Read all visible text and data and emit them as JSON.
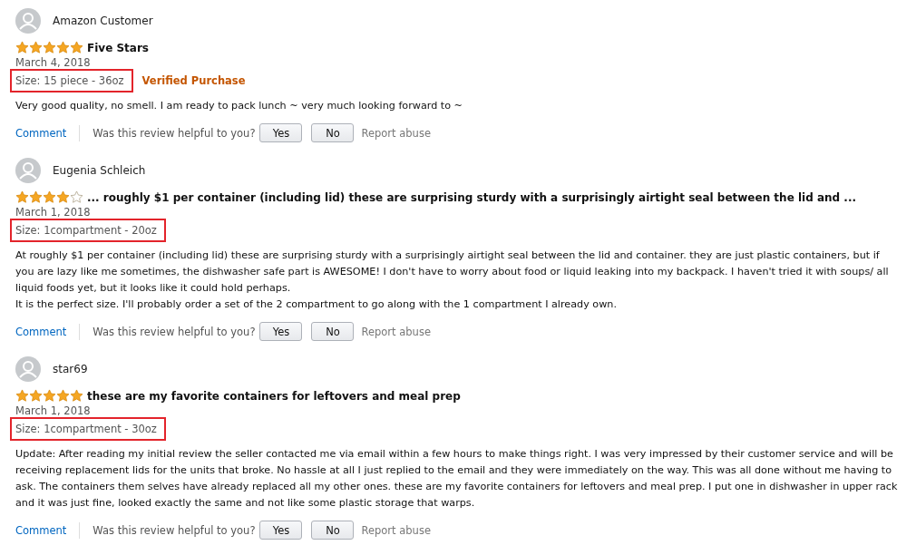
{
  "reviews": [
    {
      "author": "Amazon Customer",
      "stars": 5,
      "title": "Five Stars",
      "date": "March 4, 2018",
      "size": "Size: 15 piece - 36oz",
      "badge": "Verified Purchase",
      "body": [
        "Very good quality, no smell. I am ready to pack lunch ~ very much looking forward to ~"
      ],
      "actions": {
        "comment": "Comment",
        "question": "Was this review helpful to you?",
        "yes": "Yes",
        "no": "No",
        "report": "Report abuse"
      }
    },
    {
      "author": "Eugenia Schleich",
      "stars": 4,
      "title": "... roughly $1 per container (including lid) these are surprising sturdy with a surprisingly airtight seal between the lid and ...",
      "date": "March 1, 2018",
      "size": "Size: 1compartment - 20oz",
      "body": [
        "At roughly $1 per container (including lid) these are surprising sturdy with a surprisingly airtight seal between the lid and container. they are just plastic containers, but if you are lazy like me sometimes, the dishwasher safe part is AWESOME! I don't have to worry about food or liquid leaking into my backpack. I haven't tried it with soups/ all liquid foods yet, but it looks like it could hold perhaps.",
        "It is the perfect size. I'll probably order a set of the 2 compartment to go along with the 1 compartment I already own."
      ],
      "actions": {
        "comment": "Comment",
        "question": "Was this review helpful to you?",
        "yes": "Yes",
        "no": "No",
        "report": "Report abuse"
      }
    },
    {
      "author": "star69",
      "stars": 5,
      "title": "these are my favorite containers for leftovers and meal prep",
      "date": "March 1, 2018",
      "size": "Size: 1compartment - 30oz",
      "body": [
        "Update: After reading my initial review the seller contacted me via email within a few hours to make things right. I was very impressed by their customer service and will be receiving replacement lids for the units that broke. No hassle at all I just replied to the email and they were immediately on the way. This was all done without me having to ask. The containers them selves have already replaced all my other ones. these are my favorite containers for leftovers and meal prep. I put one in dishwasher in upper rack and it was just fine, looked exactly the same and not like some plastic storage that warps."
      ],
      "actions": {
        "comment": "Comment",
        "question": "Was this review helpful to you?",
        "yes": "Yes",
        "no": "No",
        "report": "Report abuse"
      }
    }
  ]
}
